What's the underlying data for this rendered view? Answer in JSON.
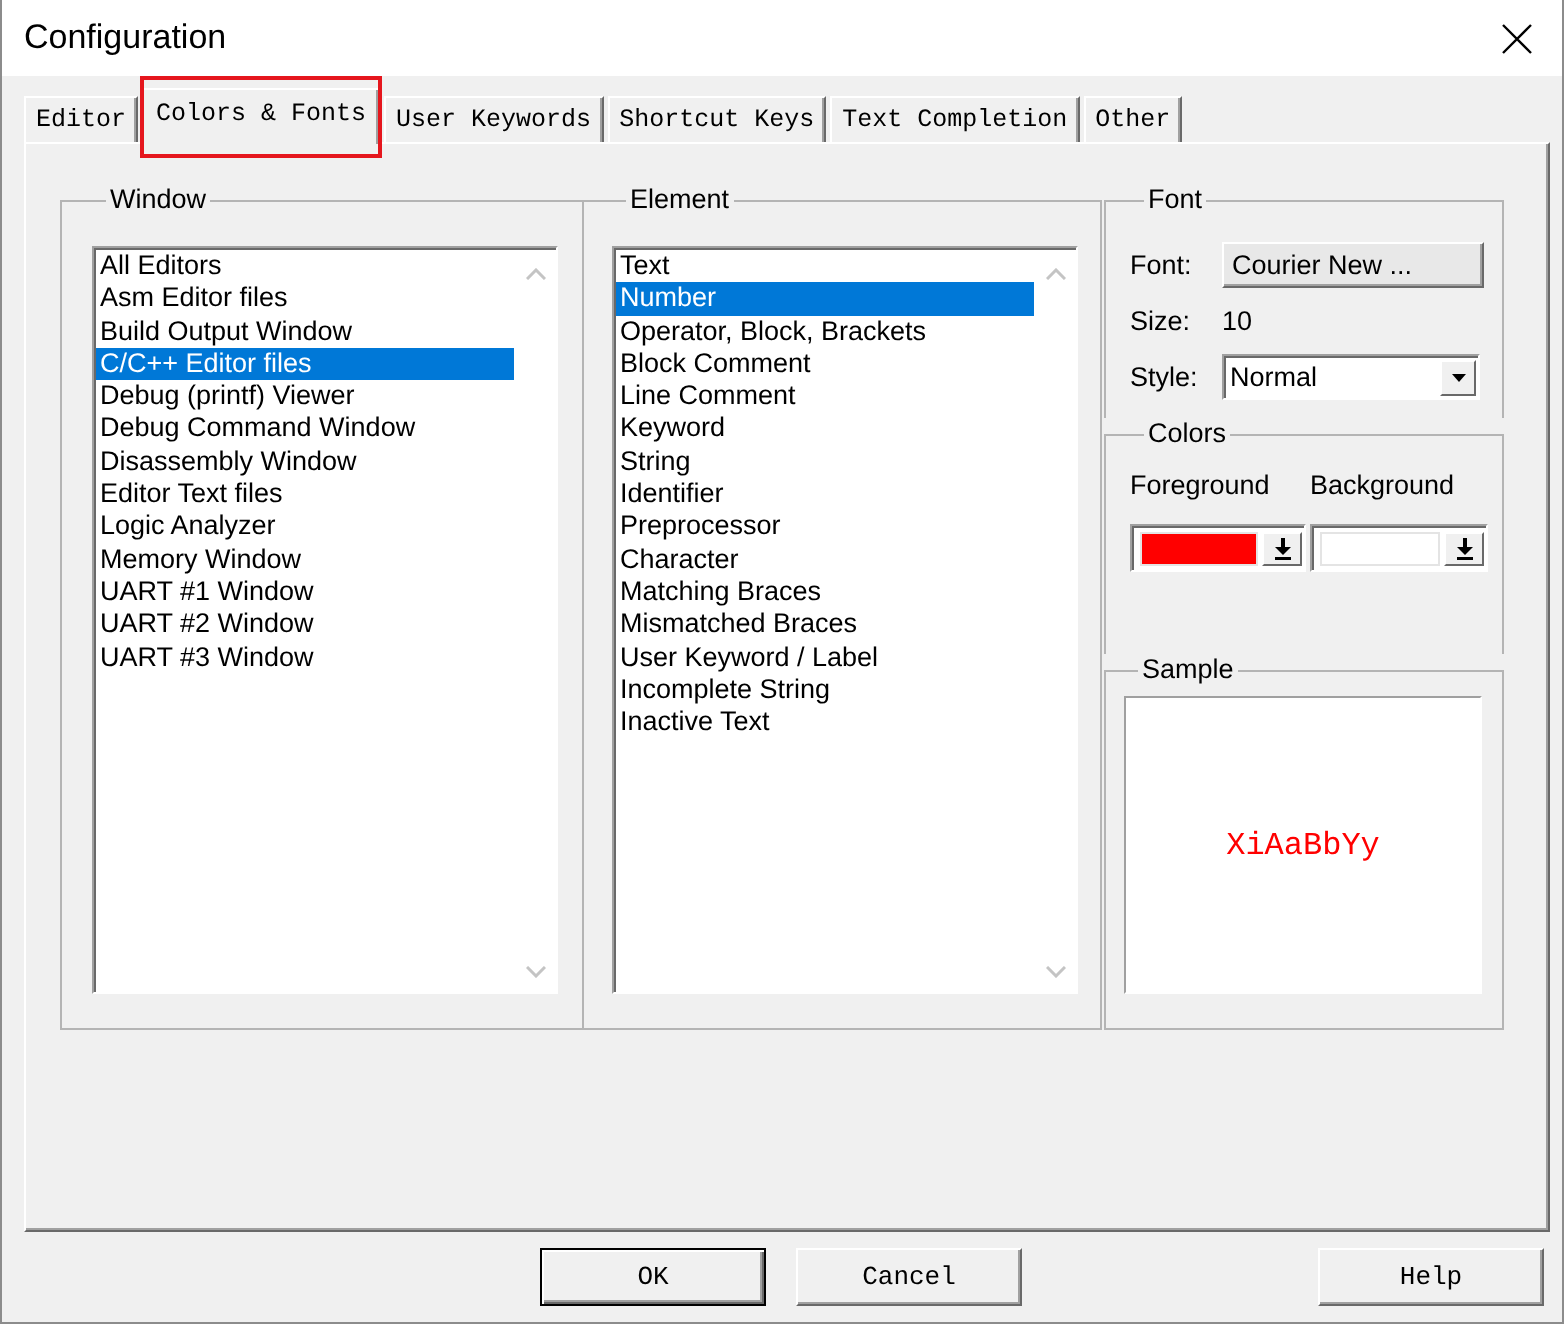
{
  "window": {
    "title": "Configuration"
  },
  "tabs": [
    {
      "label": "Editor",
      "selected": false,
      "highlighted": false
    },
    {
      "label": "Colors & Fonts",
      "selected": true,
      "highlighted": true
    },
    {
      "label": "User Keywords",
      "selected": false,
      "highlighted": false
    },
    {
      "label": "Shortcut Keys",
      "selected": false,
      "highlighted": false
    },
    {
      "label": "Text Completion",
      "selected": false,
      "highlighted": false
    },
    {
      "label": "Other",
      "selected": false,
      "highlighted": false
    }
  ],
  "window_group": {
    "label": "Window",
    "items": [
      {
        "label": "All Editors",
        "selected": false
      },
      {
        "label": "Asm Editor files",
        "selected": false
      },
      {
        "label": "Build Output Window",
        "selected": false
      },
      {
        "label": "C/C++ Editor files",
        "selected": true
      },
      {
        "label": "Debug (printf) Viewer",
        "selected": false
      },
      {
        "label": "Debug Command Window",
        "selected": false
      },
      {
        "label": "Disassembly Window",
        "selected": false
      },
      {
        "label": "Editor Text files",
        "selected": false
      },
      {
        "label": "Logic Analyzer",
        "selected": false
      },
      {
        "label": "Memory Window",
        "selected": false
      },
      {
        "label": "UART #1 Window",
        "selected": false
      },
      {
        "label": "UART #2 Window",
        "selected": false
      },
      {
        "label": "UART #3 Window",
        "selected": false
      }
    ]
  },
  "element_group": {
    "label": "Element",
    "items": [
      {
        "label": "Text",
        "selected": false
      },
      {
        "label": "Number",
        "selected": true
      },
      {
        "label": "Operator, Block, Brackets",
        "selected": false
      },
      {
        "label": "Block Comment",
        "selected": false
      },
      {
        "label": "Line Comment",
        "selected": false
      },
      {
        "label": "Keyword",
        "selected": false
      },
      {
        "label": "String",
        "selected": false
      },
      {
        "label": "Identifier",
        "selected": false
      },
      {
        "label": "Preprocessor",
        "selected": false
      },
      {
        "label": "Character",
        "selected": false
      },
      {
        "label": "Matching Braces",
        "selected": false
      },
      {
        "label": "Mismatched Braces",
        "selected": false
      },
      {
        "label": "User Keyword / Label",
        "selected": false
      },
      {
        "label": "Incomplete String",
        "selected": false
      },
      {
        "label": "Inactive Text",
        "selected": false
      }
    ]
  },
  "font_group": {
    "label": "Font",
    "font_label": "Font:",
    "font_button": "Courier New ...",
    "size_label": "Size:",
    "size_value": "10",
    "style_label": "Style:",
    "style_value": "Normal"
  },
  "colors_group": {
    "label": "Colors",
    "items": [
      {
        "label": "Foreground",
        "color": "#ff0000"
      },
      {
        "label": "Background",
        "color": "#ffffff"
      }
    ]
  },
  "sample_group": {
    "label": "Sample",
    "text": "XiAaBbYy"
  },
  "buttons": [
    {
      "label": "OK",
      "default": true
    },
    {
      "label": "Cancel",
      "default": false
    },
    {
      "label": "Help",
      "default": false
    }
  ]
}
